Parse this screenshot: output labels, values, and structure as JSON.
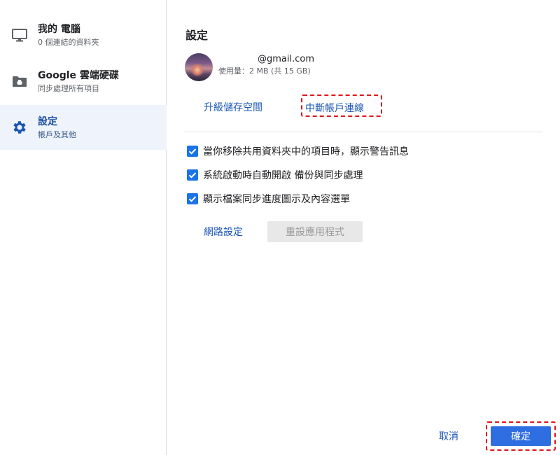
{
  "sidebar": {
    "items": [
      {
        "title": "我的 電腦",
        "subtitle": "0 個連結的資料夾",
        "icon": "monitor-icon"
      },
      {
        "title": "Google 雲端硬碟",
        "subtitle": "同步處理所有項目",
        "icon": "drive-folder-icon"
      },
      {
        "title": "設定",
        "subtitle": "帳戶及其他",
        "icon": "gear-icon"
      }
    ],
    "active_index": 2
  },
  "main": {
    "title": "設定",
    "account": {
      "email": "@gmail.com",
      "storage": "使用量：2 MB (共 15 GB)"
    },
    "links": {
      "upgrade": "升級儲存空間",
      "disconnect": "中斷帳戶連線"
    },
    "options": [
      {
        "label": "當你移除共用資料夾中的項目時，顯示警告訊息",
        "checked": true
      },
      {
        "label": "系統啟動時自動開啟 備份與同步處理",
        "checked": true
      },
      {
        "label": "顯示檔案同步進度圖示及內容選單",
        "checked": true
      }
    ],
    "network_settings": "網路設定",
    "reset_app": "重設應用程式"
  },
  "footer": {
    "cancel": "取消",
    "ok": "確定"
  },
  "colors": {
    "accent": "#1a73e8",
    "link": "#1a55b3",
    "highlight_border": "#e0141a",
    "active_nav_bg": "#eef3fc"
  }
}
